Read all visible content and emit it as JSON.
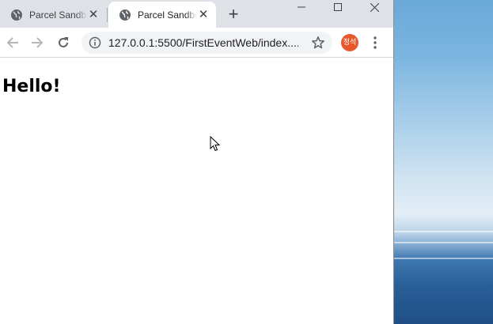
{
  "window": {
    "controls": [
      "minimize-icon",
      "maximize-icon",
      "close-icon"
    ]
  },
  "tabs": [
    {
      "title": "Parcel Sandbox",
      "icon": "globe-icon",
      "active": false
    },
    {
      "title": "Parcel Sandbox",
      "icon": "globe-icon",
      "active": true
    }
  ],
  "toolbar": {
    "url": "127.0.0.1:5500/FirstEventWeb/index....",
    "profile_label": "정석",
    "profile_color": "#e8572a"
  },
  "page": {
    "heading": "Hello!"
  }
}
